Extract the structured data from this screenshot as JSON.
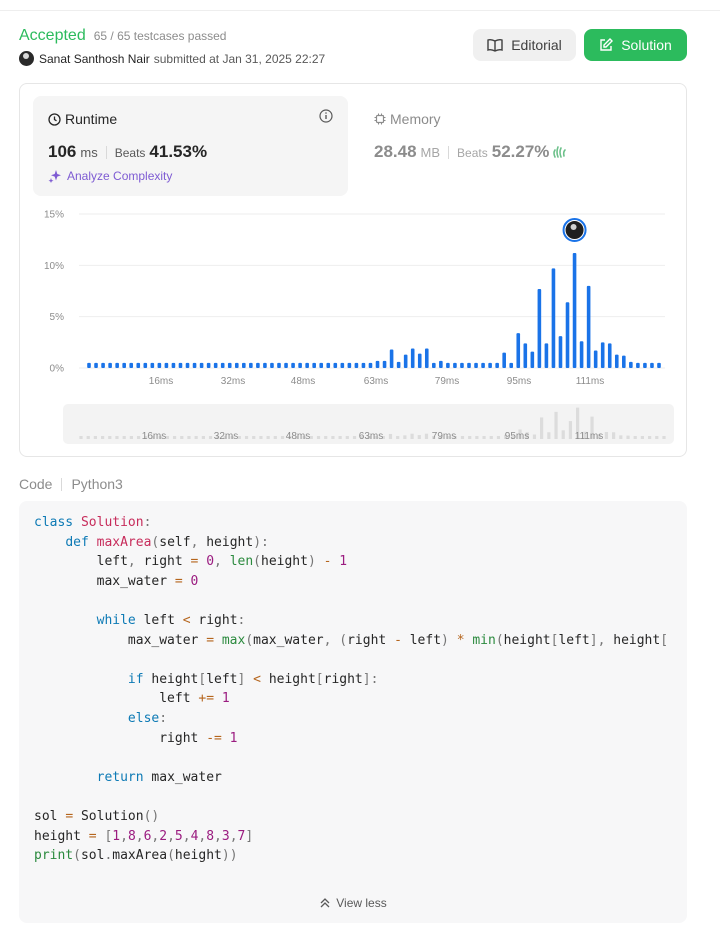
{
  "header": {
    "status": "Accepted",
    "testcases": "65 / 65 testcases passed",
    "author": "Sanat Santhosh Nair",
    "submitted": "submitted at Jan 31, 2025 22:27",
    "editorial_label": "Editorial",
    "solution_label": "Solution"
  },
  "runtime": {
    "title": "Runtime",
    "value": "106",
    "unit": "ms",
    "beats_label": "Beats",
    "beats": "41.53%",
    "analyze_label": "Analyze Complexity"
  },
  "memory": {
    "title": "Memory",
    "value": "28.48",
    "unit": "MB",
    "beats_label": "Beats",
    "beats": "52.27%"
  },
  "colors": {
    "accepted": "#2cbb5d",
    "bar": "#1a73e8",
    "analyze": "#7e5bd3"
  },
  "chart_data": {
    "type": "bar",
    "y_ticks": [
      "15%",
      "10%",
      "5%",
      "0%"
    ],
    "ylim": [
      0,
      15
    ],
    "x_ticks": [
      "16ms",
      "32ms",
      "48ms",
      "63ms",
      "79ms",
      "95ms",
      "111ms"
    ],
    "values": [
      0.5,
      0.5,
      0.5,
      0.5,
      0.5,
      0.5,
      0.5,
      0.5,
      0.5,
      0.5,
      0.5,
      0.5,
      0.5,
      0.5,
      0.5,
      0.5,
      0.5,
      0.5,
      0.5,
      0.5,
      0.5,
      0.5,
      0.5,
      0.5,
      0.5,
      0.5,
      0.5,
      0.5,
      0.5,
      0.5,
      0.5,
      0.5,
      0.5,
      0.5,
      0.5,
      0.5,
      0.5,
      0.5,
      0.5,
      0.5,
      0.5,
      0.7,
      0.7,
      1.8,
      0.6,
      1.3,
      1.9,
      1.4,
      1.9,
      0.5,
      0.7,
      0.5,
      0.5,
      0.5,
      0.5,
      0.5,
      0.5,
      0.5,
      0.5,
      1.5,
      0.5,
      3.4,
      2.4,
      1.6,
      7.7,
      2.4,
      9.7,
      3.1,
      6.4,
      11.2,
      2.6,
      8.0,
      1.7,
      2.5,
      2.4,
      1.3,
      1.2,
      0.6,
      0.5,
      0.5,
      0.5,
      0.5
    ],
    "highlight_index": 69
  },
  "code": {
    "label": "Code",
    "language": "Python3",
    "view_less": "View less"
  }
}
